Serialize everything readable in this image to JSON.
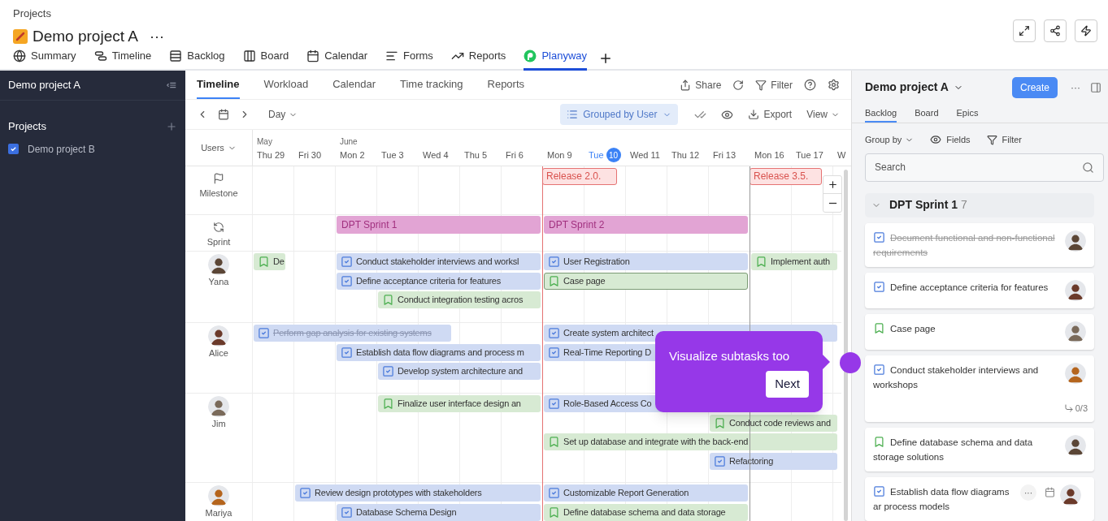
{
  "header": {
    "breadcrumb": "Projects",
    "title": "Demo project A",
    "more": "···",
    "tabs": [
      {
        "kind": "globe",
        "label": "Summary",
        "selected": false
      },
      {
        "kind": "timeline",
        "label": "Timeline",
        "selected": false
      },
      {
        "kind": "backlog",
        "label": "Backlog",
        "selected": false
      },
      {
        "kind": "board",
        "label": "Board",
        "selected": false
      },
      {
        "kind": "calendar",
        "label": "Calendar",
        "selected": false
      },
      {
        "kind": "forms",
        "label": "Forms",
        "selected": false
      },
      {
        "kind": "reports",
        "label": "Reports",
        "selected": false
      },
      {
        "kind": "planyway",
        "label": "Planyway",
        "selected": true
      }
    ]
  },
  "sidebar": {
    "title": "Demo project A",
    "section": "Projects",
    "projects": [
      {
        "label": "Demo project B",
        "checked": true
      }
    ]
  },
  "timeline": {
    "tabs": [
      {
        "label": "Timeline",
        "selected": true
      },
      {
        "label": "Workload",
        "selected": false
      },
      {
        "label": "Calendar",
        "selected": false
      },
      {
        "label": "Time tracking",
        "selected": false
      },
      {
        "label": "Reports",
        "selected": false
      }
    ],
    "actions": {
      "share": "Share",
      "filter": "Filter"
    },
    "toolbar": {
      "scale": "Day",
      "grouping": "Grouped by User",
      "export": "Export",
      "view": "View"
    },
    "users_menu": "Users",
    "months": [
      {
        "label": "May"
      },
      {
        "label": "June"
      }
    ],
    "days": [
      {
        "weekday": "Thu",
        "date": "29",
        "today": false
      },
      {
        "weekday": "Fri",
        "date": "30",
        "today": false
      },
      {
        "weekday": "Mon",
        "date": "2",
        "today": false
      },
      {
        "weekday": "Tue",
        "date": "3",
        "today": false
      },
      {
        "weekday": "Wed",
        "date": "4",
        "today": false
      },
      {
        "weekday": "Thu",
        "date": "5",
        "today": false
      },
      {
        "weekday": "Fri",
        "date": "6",
        "today": false
      },
      {
        "weekday": "Mon",
        "date": "9",
        "today": false
      },
      {
        "weekday": "Tue",
        "date": "10",
        "today": true
      },
      {
        "weekday": "Wed",
        "date": "11",
        "today": false
      },
      {
        "weekday": "Thu",
        "date": "12",
        "today": false
      },
      {
        "weekday": "Fri",
        "date": "13",
        "today": false
      },
      {
        "weekday": "Mon",
        "date": "16",
        "today": false
      },
      {
        "weekday": "Tue",
        "date": "17",
        "today": false
      },
      {
        "weekday": "W",
        "today": false
      }
    ],
    "rows": [
      {
        "kind": "milestone",
        "label": "Milestone",
        "items": [
          {
            "text": "Release 2.0."
          },
          {
            "text": "Release 3.5."
          }
        ]
      },
      {
        "kind": "sprint",
        "label": "Sprint",
        "items": [
          {
            "text": "DPT Sprint 1"
          },
          {
            "text": "DPT Sprint 2"
          }
        ]
      },
      {
        "kind": "user",
        "label": "Yana",
        "items": [
          {
            "kind": "story",
            "text": "De",
            "done": false,
            "selected": false
          },
          {
            "kind": "task",
            "text": "Conduct stakeholder interviews and worksl",
            "done": false,
            "selected": false
          },
          {
            "kind": "task",
            "text": "User Registration",
            "done": false,
            "selected": false
          },
          {
            "kind": "story",
            "text": "Implement auth",
            "done": false,
            "selected": false
          },
          {
            "kind": "task",
            "text": "Define acceptance criteria for features",
            "done": false,
            "selected": false
          },
          {
            "kind": "story",
            "text": "Case page",
            "done": false,
            "selected": true
          },
          {
            "kind": "story",
            "text": "Conduct integration testing acros",
            "done": false,
            "selected": false
          }
        ]
      },
      {
        "kind": "user",
        "label": "Alice",
        "items": [
          {
            "kind": "task",
            "text": "Perform gap analysis for existing systems",
            "done": true,
            "selected": false
          },
          {
            "kind": "task",
            "text": "Create system architect",
            "done": false,
            "selected": false
          },
          {
            "kind": "task",
            "text": "Establish data flow diagrams and process m",
            "done": false,
            "selected": false
          },
          {
            "kind": "task",
            "text": "Real-Time Reporting D",
            "done": false,
            "selected": false
          },
          {
            "kind": "task",
            "text": "Develop system architecture and",
            "done": false,
            "selected": false
          }
        ]
      },
      {
        "kind": "user",
        "label": "Jim",
        "items": [
          {
            "kind": "story",
            "text": "Finalize user interface design an",
            "done": false,
            "selected": false
          },
          {
            "kind": "task",
            "text": "Role-Based Access Co",
            "done": false,
            "selected": false
          },
          {
            "kind": "story",
            "text": "Conduct code reviews and",
            "done": false,
            "selected": false
          },
          {
            "kind": "story",
            "text": "Set up database and integrate with the back-end",
            "done": false,
            "selected": false
          },
          {
            "kind": "task",
            "text": "Refactoring",
            "done": false,
            "selected": false
          }
        ]
      },
      {
        "kind": "user",
        "label": "Mariya",
        "items": [
          {
            "kind": "task",
            "text": "Review design prototypes with stakeholders",
            "done": false,
            "selected": false
          },
          {
            "kind": "task",
            "text": "Customizable Report Generation",
            "done": false,
            "selected": false
          },
          {
            "kind": "task",
            "text": "Database Schema Design",
            "done": false,
            "selected": false
          },
          {
            "kind": "story",
            "text": "Define database schema and data storage",
            "done": false,
            "selected": false
          }
        ]
      }
    ],
    "tour": {
      "text": "Visualize subtasks too",
      "button": "Next"
    }
  },
  "panel": {
    "title": "Demo project A",
    "create": "Create",
    "more": "···",
    "tabs": [
      {
        "label": "Backlog",
        "selected": true
      },
      {
        "label": "Board",
        "selected": false
      },
      {
        "label": "Epics",
        "selected": false
      }
    ],
    "group_by": "Group by",
    "fields": "Fields",
    "filter": "Filter",
    "search": {
      "placeholder": "Search"
    },
    "sprint": {
      "name": "DPT Sprint 1",
      "count": "7",
      "expanded": true
    },
    "cards": [
      {
        "kind": "task",
        "text": "Document functional and non-functional requirements",
        "done": true,
        "hovered": false
      },
      {
        "kind": "task",
        "text": "Define acceptance criteria for features",
        "done": false,
        "hovered": false
      },
      {
        "kind": "story",
        "text": "Case page",
        "done": false,
        "hovered": false
      },
      {
        "kind": "task",
        "text": "Conduct stakeholder interviews and workshops",
        "done": false,
        "subtasks": "0/3",
        "hovered": false
      },
      {
        "kind": "story",
        "text": "Define database schema and data storage solutions",
        "done": false,
        "hovered": false
      },
      {
        "kind": "task",
        "text": "Establish data flow diagrams ar process models",
        "done": false,
        "hovered": true
      }
    ]
  }
}
